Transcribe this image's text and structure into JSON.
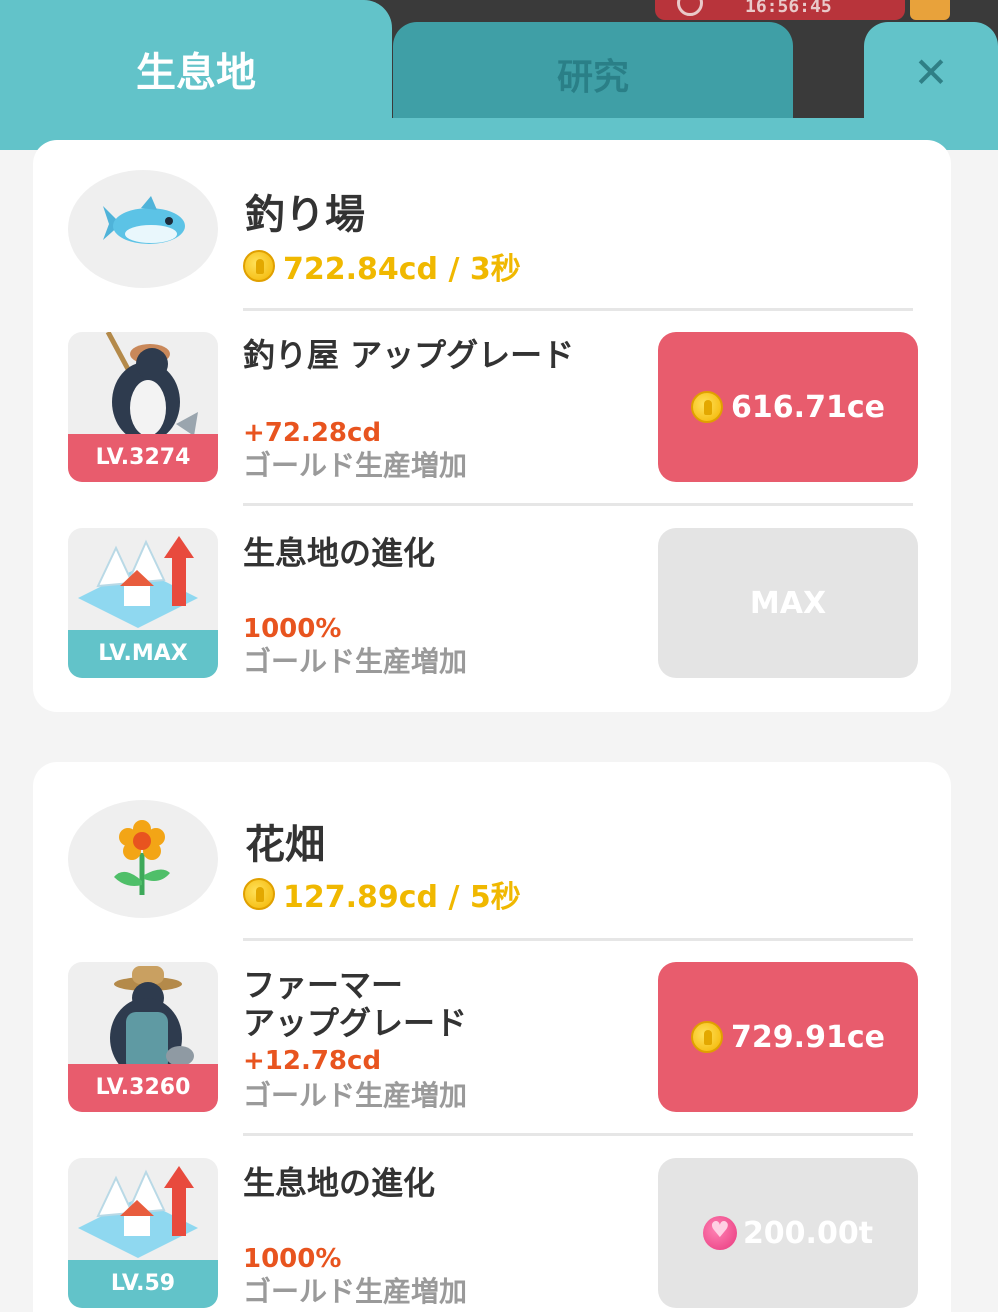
{
  "top": {
    "timer": "16:56:45",
    "tabs": {
      "habitat": "生息地",
      "research": "研究",
      "close": "✕"
    }
  },
  "habitats": [
    {
      "title": "釣り場",
      "rate": "722.84cd / 3秒",
      "icon": "fish-icon",
      "upgrade": {
        "level": "LV.3274",
        "title": "釣り屋 アップグレード",
        "bonus": "+72.28cd",
        "desc": "ゴールド生産増加",
        "cost": "616.71ce",
        "currency": "gold-coin-icon"
      },
      "evolution": {
        "level": "LV.MAX",
        "title": "生息地の進化",
        "bonus": "1000%",
        "desc": "ゴールド生産増加",
        "button": "MAX"
      }
    },
    {
      "title": "花畑",
      "rate": "127.89cd / 5秒",
      "icon": "flower-icon",
      "upgrade": {
        "level": "LV.3260",
        "title_line1": "ファーマー",
        "title_line2": "アップグレード",
        "bonus": "+12.78cd",
        "desc": "ゴールド生産増加",
        "cost": "729.91ce",
        "currency": "gold-coin-icon"
      },
      "evolution": {
        "level": "LV.59",
        "title": "生息地の進化",
        "bonus": "1000%",
        "desc": "ゴールド生産増加",
        "cost": "200.00t",
        "currency": "heart-gem-icon"
      }
    }
  ],
  "colors": {
    "teal": "#62c3c9",
    "teal_dark": "#3f9fa6",
    "red_button": "#e85c6d",
    "gold_text": "#f0b800",
    "bonus_text": "#e8541f",
    "grey_text": "#9a9a9a"
  }
}
